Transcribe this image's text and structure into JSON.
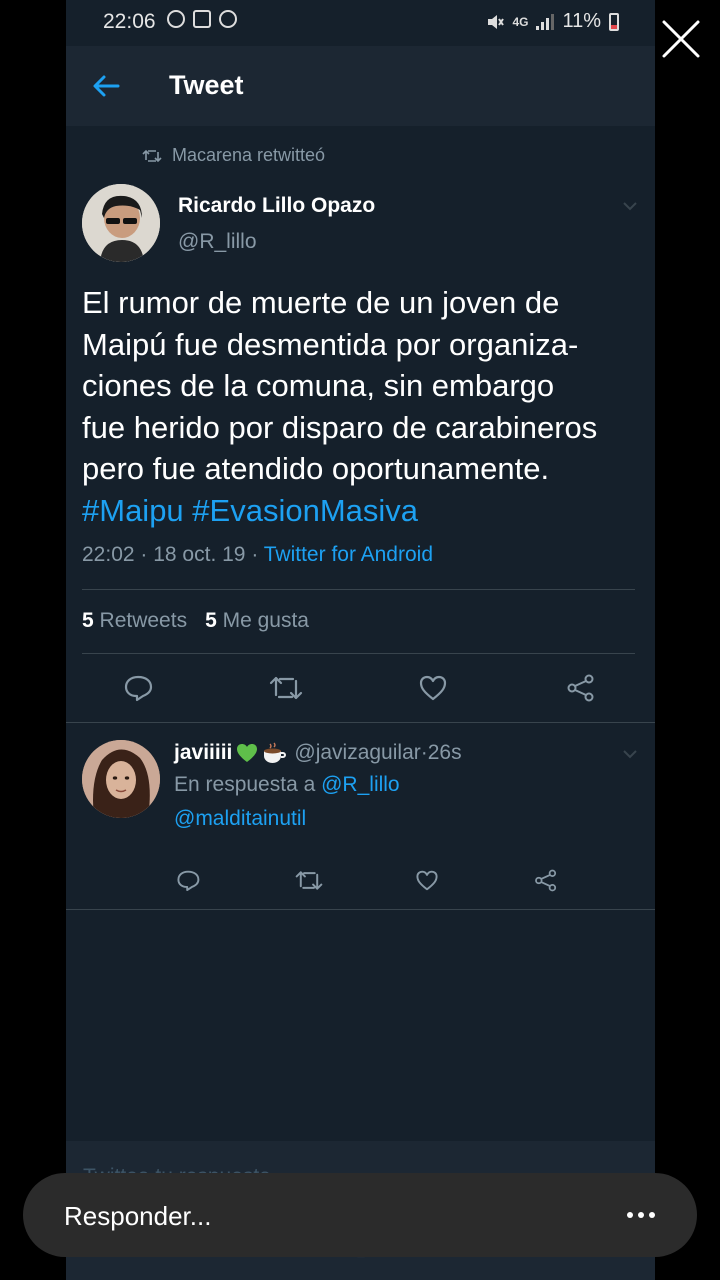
{
  "status_bar": {
    "time": "22:06",
    "network": "4G",
    "battery": "11%"
  },
  "header": {
    "title": "Tweet"
  },
  "tweet": {
    "retweet_note": "Macarena retwitteó",
    "author_name": "Ricardo Lillo Opazo",
    "author_handle": "@R_lillo",
    "text_lines": [
      "El rumor de muerte de un joven de",
      "Maipú fue desmentida por organiza-",
      "ciones de la comuna, sin embargo",
      "fue herido por disparo de carabineros",
      "pero fue atendido oportunamente."
    ],
    "hashtags": "#Maipu #EvasionMasiva",
    "time": "22:02",
    "date": "18 oct. 19",
    "source": "Twitter for Android",
    "retweets_count": "5",
    "retweets_label": "Retweets",
    "likes_count": "5",
    "likes_label": "Me gusta"
  },
  "reply": {
    "name": "javiiiii",
    "handle": "@javizaguilar",
    "age": "26s",
    "in_reply_prefix": "En respuesta a",
    "in_reply_to": "@R_lillo",
    "mention": "@malditainutil"
  },
  "compose": {
    "placeholder": "Twittea tu respuesta"
  },
  "overlay": {
    "reply_label": "Responder..."
  },
  "colors": {
    "background": "#15202b",
    "header": "#1c2733",
    "accent": "#1da1f2",
    "secondary_text": "#8899a6",
    "divider": "#38444d"
  }
}
